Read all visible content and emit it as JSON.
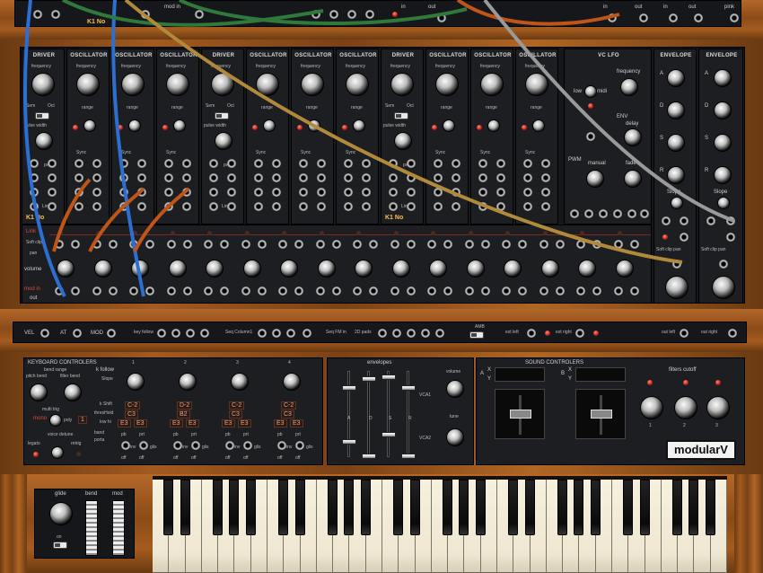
{
  "top_strip": {
    "k1_label": "K1 No",
    "labels": [
      "mod in",
      "in",
      "out",
      "in",
      "out",
      "in",
      "out",
      "pink"
    ]
  },
  "modules": [
    {
      "title": "DRIVER"
    },
    {
      "title": "OSCILLATOR"
    },
    {
      "title": "OSCILLATOR"
    },
    {
      "title": "OSCILLATOR"
    },
    {
      "title": "DRIVER"
    },
    {
      "title": "OSCILLATOR"
    },
    {
      "title": "OSCILLATOR"
    },
    {
      "title": "OSCILLATOR"
    },
    {
      "title": "DRIVER"
    },
    {
      "title": "OSCILLATOR"
    },
    {
      "title": "OSCILLATOR"
    },
    {
      "title": "OSCILLATOR"
    }
  ],
  "osc_labels": {
    "frequency": "frequency",
    "range": "range",
    "sync": "Sync",
    "semi": "Sem",
    "oct": "Oct",
    "pulse_width": "pulse width",
    "pwm": "pwm",
    "lin": "Lin",
    "k1no": "K1 No"
  },
  "vc_lfo": {
    "title": "VC LFO",
    "frequency": "frequency",
    "low": "low",
    "midi": "midi",
    "env": "ENV",
    "delay": "delay",
    "pwm": "PWM",
    "manual": "manual",
    "fade": "fade"
  },
  "envelopes": [
    {
      "title": "ENVELOPE",
      "letters": [
        "A",
        "D",
        "S",
        "R"
      ],
      "slope": "Slope",
      "soft_clip_pan": "Soft clip pan"
    },
    {
      "title": "ENVELOPE",
      "letters": [
        "A",
        "D",
        "S",
        "R"
      ],
      "slope": "Slope",
      "soft_clip_pan": "Soft clip pan"
    }
  ],
  "mixer_row": {
    "link": "Link",
    "soft_clip": "Soft clip",
    "pan": "pan",
    "volume": "volume",
    "mod_in": "mod in",
    "out": "out"
  },
  "utility_bar": {
    "items": [
      "VEL",
      "AT",
      "MOD",
      "key follow",
      "Seq Column1",
      "Seq FM in",
      "2D pads",
      "AMB",
      "ext left",
      "ext right",
      "out left",
      "out right"
    ]
  },
  "keyboard_controllers": {
    "title": "KEYBOARD CONTROLERS",
    "bend_range": "bend range",
    "pitch_bend": "pitch bend",
    "filter_bend": "filter bend",
    "multitrig": "multi trig",
    "mono": "mono",
    "poly": "poly",
    "poly_value": "1",
    "voice_detune": "voice detune",
    "legato": "legato",
    "retrig": "retrig",
    "k_follow": "k follow",
    "slope": "Slope",
    "k_shift": "k Shift",
    "threshold": "thresHold",
    "low_hi": "low hi",
    "band": "band",
    "porta": "porta",
    "columns": [
      {
        "num": "1",
        "shift": "C-2",
        "low": "C3",
        "l": "E3",
        "h": "E3"
      },
      {
        "num": "2",
        "shift": "D-2",
        "low": "B2",
        "l": "E3",
        "h": "E3"
      },
      {
        "num": "3",
        "shift": "C-2",
        "low": "C3",
        "l": "E3",
        "h": "E3"
      },
      {
        "num": "4",
        "shift": "C-2",
        "low": "C3",
        "l": "E3",
        "h": "E3"
      }
    ],
    "switch_labels": [
      "pb",
      "prt",
      "pb",
      "prt",
      "pb",
      "prt",
      "pb",
      "prt"
    ],
    "off_labels": [
      "off",
      "off",
      "off",
      "off",
      "off",
      "off",
      "off",
      "off"
    ],
    "inv": "inv",
    "glis": "glis"
  },
  "envelopes_panel": {
    "title": "envelopes",
    "vca1": "VCA1",
    "vca2": "VCA2",
    "volume": "volume",
    "tune": "tune",
    "letters": [
      "A",
      "D",
      "S",
      "R"
    ]
  },
  "sound_controllers": {
    "title": "SOUND CONTROLERS",
    "x": "X",
    "y": "Y",
    "a": "A",
    "b": "B",
    "filters_cutoff": "filters cutoff",
    "knob_nums": [
      "1",
      "2",
      "3"
    ]
  },
  "brand": {
    "logo": "modularV"
  },
  "wheels": {
    "glide": "glide",
    "bend": "bend",
    "mod": "mod",
    "on": "on"
  }
}
